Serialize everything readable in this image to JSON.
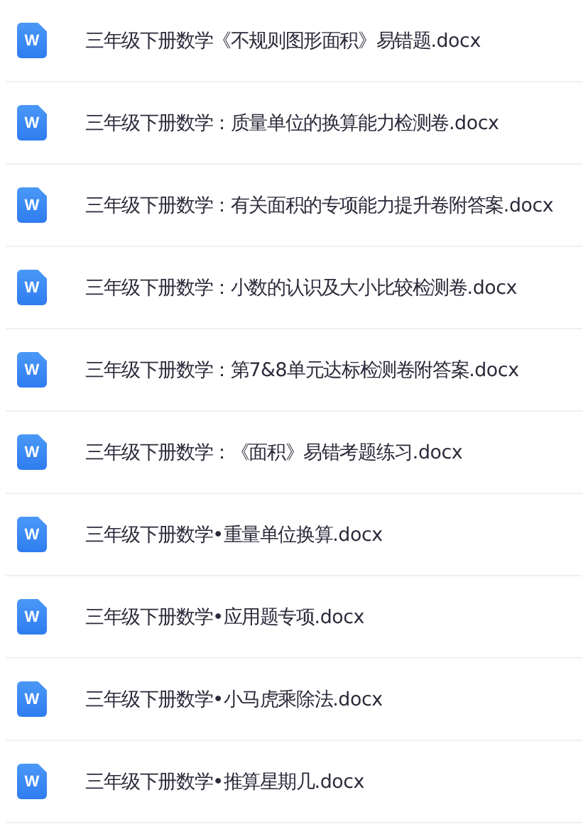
{
  "files": [
    {
      "name": "三年级下册数学《不规则图形面积》易错题.docx",
      "icon_label": "W"
    },
    {
      "name": "三年级下册数学：质量单位的换算能力检测卷.docx",
      "icon_label": "W"
    },
    {
      "name": "三年级下册数学：有关面积的专项能力提升卷附答案.docx",
      "icon_label": "W"
    },
    {
      "name": "三年级下册数学：小数的认识及大小比较检测卷.docx",
      "icon_label": "W"
    },
    {
      "name": "三年级下册数学：第7&8单元达标检测卷附答案.docx",
      "icon_label": "W"
    },
    {
      "name": "三年级下册数学：《面积》易错考题练习.docx",
      "icon_label": "W"
    },
    {
      "name": "三年级下册数学•重量单位换算.docx",
      "icon_label": "W"
    },
    {
      "name": "三年级下册数学•应用题专项.docx",
      "icon_label": "W"
    },
    {
      "name": "三年级下册数学•小马虎乘除法.docx",
      "icon_label": "W"
    },
    {
      "name": "三年级下册数学•推算星期几.docx",
      "icon_label": "W"
    }
  ]
}
